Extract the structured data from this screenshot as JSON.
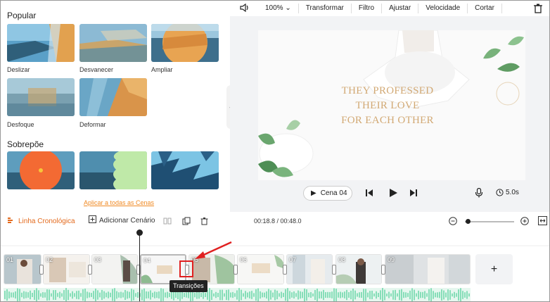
{
  "left_panel": {
    "section_popular": "Popular",
    "popular_items": [
      "Deslizar",
      "Desvanecer",
      "Ampliar",
      "Desfoque",
      "Deformar"
    ],
    "section_overlay": "Sobrepõe",
    "apply_all": "Aplicar a todas as Cenas"
  },
  "toolbar": {
    "volume_icon": "speaker-icon",
    "zoom": "100%",
    "items": [
      "Transformar",
      "Filtro",
      "Ajustar",
      "Velocidade",
      "Cortar"
    ],
    "delete_icon": "trash-icon"
  },
  "canvas": {
    "lines": [
      "THEY PROFESSED",
      "THEIR LOVE",
      "FOR EACH OTHER"
    ]
  },
  "controls": {
    "scene": "Cena 04",
    "duration": "5.0s"
  },
  "timeline_bar": {
    "tab_label": "Linha Cronológica",
    "add_scene": "Adicionar Cenário",
    "time": "00:18.8 / 00:48.0"
  },
  "clips": [
    "01",
    "02",
    "03",
    "04",
    "05",
    "06",
    "07",
    "08",
    "09"
  ],
  "tooltip": "Transições",
  "colors": {
    "accent": "#e36a1d",
    "link": "#f08a24",
    "audio": "#5dd3a0",
    "text_gold": "#d2a974",
    "highlight": "#e02020"
  }
}
